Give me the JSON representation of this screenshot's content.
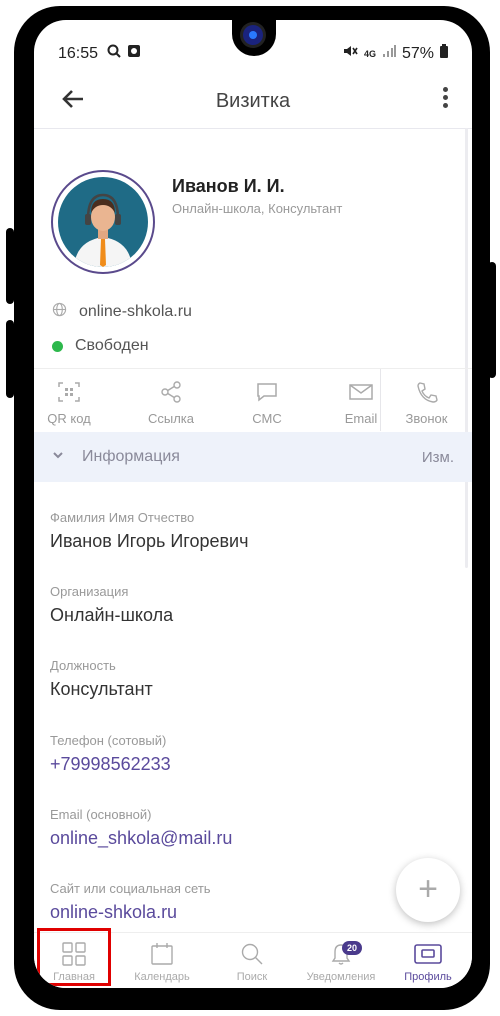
{
  "status": {
    "time": "16:55",
    "battery": "57%",
    "network": "4G"
  },
  "appbar": {
    "title": "Визитка"
  },
  "profile": {
    "name": "Иванов И. И.",
    "subtitle": "Онлайн-школа, Консультант",
    "website": "online-shkola.ru",
    "status_text": "Свободен",
    "status_color": "#2db84c"
  },
  "actions": [
    {
      "label": "QR код",
      "icon": "qr-icon"
    },
    {
      "label": "Ссылка",
      "icon": "share-icon"
    },
    {
      "label": "СМС",
      "icon": "sms-icon"
    },
    {
      "label": "Email",
      "icon": "email-icon"
    },
    {
      "label": "Звонок",
      "icon": "phone-icon"
    }
  ],
  "info": {
    "title": "Информация",
    "edit": "Изм."
  },
  "fields": [
    {
      "label": "Фамилия Имя Отчество",
      "value": "Иванов Игорь Игоревич"
    },
    {
      "label": "Организация",
      "value": "Онлайн-школа"
    },
    {
      "label": "Должность",
      "value": "Консультант"
    },
    {
      "label": "Телефон  (сотовый)",
      "value": "+79998562233"
    },
    {
      "label": "Email (основной)",
      "value": "online_shkola@mail.ru"
    },
    {
      "label": "Сайт или социальная сеть",
      "value": "online-shkola.ru"
    }
  ],
  "bottom_nav": [
    {
      "label": "Главная",
      "icon": "grid-icon"
    },
    {
      "label": "Календарь",
      "icon": "calendar-icon"
    },
    {
      "label": "Поиск",
      "icon": "search-icon"
    },
    {
      "label": "Уведомления",
      "icon": "bell-icon",
      "badge": "20"
    },
    {
      "label": "Профиль",
      "icon": "profile-card-icon"
    }
  ],
  "colors": {
    "accent": "#5a4a9c",
    "highlight": "#e00000"
  }
}
